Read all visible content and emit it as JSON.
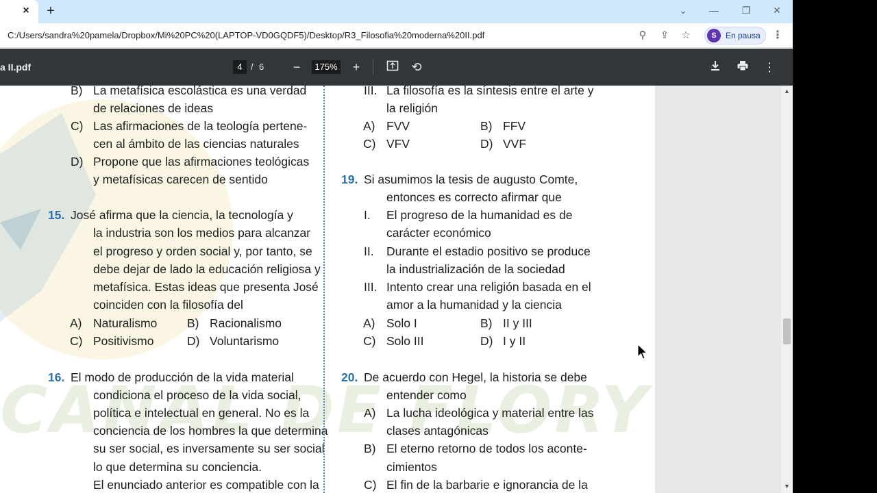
{
  "browser": {
    "tab_close": "×",
    "new_tab": "+",
    "url": "C:/Users/sandra%20pamela/Dropbox/Mi%20PC%20(LAPTOP-VD0GQDF5)/Desktop/R3_Filosofia%20moderna%20II.pdf",
    "profile_initial": "S",
    "profile_label": "En pausa",
    "window_controls": [
      "chevron-down-icon",
      "minimize-icon",
      "restore-icon",
      "close-icon"
    ]
  },
  "pdf_toolbar": {
    "title": "a II.pdf",
    "page_current": "4",
    "page_separator": "/",
    "page_total": "6",
    "zoom": "175%"
  },
  "left_column": [
    {
      "prefix": "B)",
      "text": "La metafísica escolástica es una verdad"
    },
    {
      "prefix": "",
      "text": "de relaciones de ideas"
    },
    {
      "prefix": "C)",
      "text": "Las afirmaciones de la teología pertene-"
    },
    {
      "prefix": "",
      "text": "cen al ámbito de las ciencias naturales"
    },
    {
      "prefix": "D)",
      "text": "Propone que las afirmaciones teológicas"
    },
    {
      "prefix": "",
      "text": "y metafísicas carecen de sentido"
    },
    {
      "qnum": "15.",
      "text": "José afirma que la ciencia, la tecnología y"
    },
    {
      "prefix": "",
      "text": "la industria son los medios para alcanzar"
    },
    {
      "prefix": "",
      "text": "el progreso y orden social y, por tanto, se"
    },
    {
      "prefix": "",
      "text": "debe dejar de lado la educación religiosa y"
    },
    {
      "prefix": "",
      "text": "metafísica. Estas ideas que presenta José"
    },
    {
      "prefix": "",
      "text": "coinciden con la filosofía del"
    },
    {
      "opts": [
        [
          "A)",
          "Naturalismo"
        ],
        [
          "B)",
          "Racionalismo"
        ]
      ]
    },
    {
      "opts": [
        [
          "C)",
          "Positivismo"
        ],
        [
          "D)",
          "Voluntarismo"
        ]
      ]
    },
    {
      "qnum": "16.",
      "text": "El modo de producción de la vida material"
    },
    {
      "prefix": "",
      "text": "condiciona el proceso de la vida social,"
    },
    {
      "prefix": "",
      "text": "política e intelectual en general. No es la"
    },
    {
      "prefix": "",
      "text": "conciencia de los hombres la que determina"
    },
    {
      "prefix": "",
      "text": "su ser social, es inversamente su ser social"
    },
    {
      "prefix": "",
      "text": "lo que determina su conciencia."
    },
    {
      "prefix": "",
      "text": "El enunciado anterior es compatible con la"
    }
  ],
  "right_column": [
    {
      "prefix": "III.",
      "text": "La filosofía es la síntesis entre el arte y"
    },
    {
      "prefix": "",
      "text": "la religión"
    },
    {
      "opts": [
        [
          "A)",
          "FVV"
        ],
        [
          "B)",
          "FFV"
        ]
      ]
    },
    {
      "opts": [
        [
          "C)",
          "VFV"
        ],
        [
          "D)",
          "VVF"
        ]
      ]
    },
    {
      "qnum": "19.",
      "text": "Si asumimos la tesis de augusto Comte,"
    },
    {
      "prefix": "",
      "text": "entonces es correcto afirmar que"
    },
    {
      "prefix": "I.",
      "text": "El progreso de la humanidad es de"
    },
    {
      "prefix": "",
      "text": "carácter económico"
    },
    {
      "prefix": "II.",
      "text": "Durante el estadio positivo se produce"
    },
    {
      "prefix": "",
      "text": "la industrialización de la sociedad"
    },
    {
      "prefix": "III.",
      "text": "Intento crear una religión basada en el"
    },
    {
      "prefix": "",
      "text": "amor a la humanidad y la ciencia"
    },
    {
      "opts": [
        [
          "A)",
          "Solo I"
        ],
        [
          "B)",
          "II y III"
        ]
      ]
    },
    {
      "opts": [
        [
          "C)",
          "Solo III"
        ],
        [
          "D)",
          "I y II"
        ]
      ]
    },
    {
      "qnum": "20.",
      "text": "De acuerdo con Hegel, la historia se debe"
    },
    {
      "prefix": "",
      "text": "entender como"
    },
    {
      "prefix": "A)",
      "text": "La lucha ideológica y material entre las"
    },
    {
      "prefix": "",
      "text": "clases antagónicas"
    },
    {
      "prefix": "B)",
      "text": "El eterno retorno de todos los aconte-"
    },
    {
      "prefix": "",
      "text": "cimientos"
    },
    {
      "prefix": "C)",
      "text": "El fin de la barbarie e ignorancia de la"
    }
  ],
  "watermark": "CANAL DE FLORY MATHS",
  "colors": {
    "question_number": "#2d6fa8",
    "pdf_toolbar": "#323639",
    "tabstrip": "#cfe8fc"
  }
}
